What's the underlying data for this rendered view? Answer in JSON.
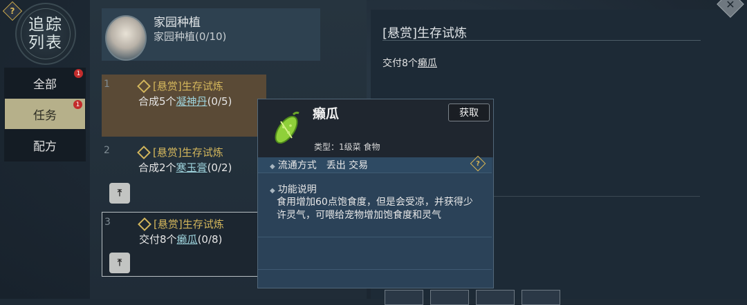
{
  "sidebar": {
    "help_glyph": "?",
    "emblem_line1": "追踪",
    "emblem_line2": "列表",
    "items": [
      {
        "label": "全部",
        "badge": "1"
      },
      {
        "label": "任务",
        "badge": "1"
      },
      {
        "label": "配方"
      }
    ]
  },
  "home_card": {
    "title": "家园种植",
    "progress": "家园种植(0/10)"
  },
  "quests": [
    {
      "num": "1",
      "tag": "[悬赏]生存试炼",
      "prefix": "合成5个",
      "item": "凝神丹",
      "count": "(0/5)"
    },
    {
      "num": "2",
      "tag": "[悬赏]生存试炼",
      "prefix": "合成2个",
      "item": "寒玉膏",
      "count": "(0/2)"
    },
    {
      "num": "3",
      "tag": "[悬赏]生存试炼",
      "prefix": "交付8个",
      "item": "癞瓜",
      "count": "(0/8)"
    }
  ],
  "detail": {
    "title": "[悬赏]生存试炼",
    "req_prefix": "交付8个",
    "req_item": "癞瓜"
  },
  "tooltip": {
    "name": "癞瓜",
    "get_button": "获取",
    "type_line": "类型：1级菜 食物",
    "circulation": "流通方式　丢出 交易",
    "func_header": "功能说明",
    "func_text": "食用增加60点饱食度，但是会受凉，并获得少许灵气，可喂给宠物增加饱食度和灵气",
    "help_glyph": "?"
  },
  "icons": {
    "close": "close-icon",
    "up": "arrow-up-icon",
    "diamond": "quest-diamond-icon",
    "help": "help-icon",
    "item": "bitter-melon-icon"
  },
  "colors": {
    "accent_gold": "#d3b65c",
    "item_link": "#9ed3dc",
    "badge_red": "#c32c2c"
  }
}
